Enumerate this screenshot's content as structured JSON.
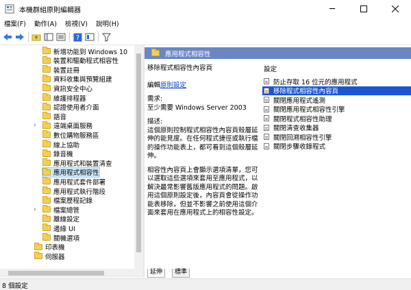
{
  "window": {
    "title": "本機群組原則編輯器"
  },
  "menu": [
    "檔案(F)",
    "動作(A)",
    "檢視(V)",
    "說明(H)"
  ],
  "tree": {
    "items": [
      {
        "label": "新增功能到 Windows 10",
        "expandable": false
      },
      {
        "label": "裝置和驅動程式相容性",
        "expandable": false
      },
      {
        "label": "裝置註冊",
        "expandable": false
      },
      {
        "label": "資料收集與預覽組建",
        "expandable": false
      },
      {
        "label": "資訊安全中心",
        "expandable": false
      },
      {
        "label": "維護排程器",
        "expandable": false
      },
      {
        "label": "認證使用者介面",
        "expandable": false
      },
      {
        "label": "語音",
        "expandable": false
      },
      {
        "label": "遠端桌面服務",
        "expandable": true
      },
      {
        "label": "數位購物服務區",
        "expandable": false
      },
      {
        "label": "線上協助",
        "expandable": false
      },
      {
        "label": "錄音機",
        "expandable": false
      },
      {
        "label": "應用程式和裝置清查",
        "expandable": false
      },
      {
        "label": "應用程式相容性",
        "expandable": false,
        "selected": true
      },
      {
        "label": "應用程式套件部署",
        "expandable": false
      },
      {
        "label": "應用程式執行階段",
        "expandable": false
      },
      {
        "label": "檔案歷程記錄",
        "expandable": false
      },
      {
        "label": "檔案總管",
        "expandable": true
      },
      {
        "label": "離線設定",
        "expandable": false
      },
      {
        "label": "邊緣 UI",
        "expandable": false
      },
      {
        "label": "關機選項",
        "expandable": false
      }
    ],
    "parent_items": [
      {
        "label": "印表機",
        "expandable": false
      },
      {
        "label": "伺服器",
        "expandable": false
      }
    ]
  },
  "detail": {
    "header": "應用程式相容性",
    "policy_title": "移除程式相容性內容頁",
    "edit_prefix": "編輯",
    "edit_link": "原則設定",
    "req_label": "需求:",
    "req_value": "至少需要 Windows Server 2003",
    "desc_label": "描述:",
    "desc_p1": "這個原則控制程式相容性內容頁殼層延伸的能見度。在任何程式捷徑或執行檔的操作功能表上，都可看到這個殼層延伸。",
    "desc_p2": "相容性內容頁上會顯示選項清單，您可以選取這些選項來套用至應用程式，以解決最常影響舊版應用程式的問題。啟用這個原則設定後，內容頁會從操作功能表移除，但並不影響之前使用這個介面來套用在應用程式上的相容性設定。"
  },
  "settings": {
    "column_header": "設定",
    "items": [
      {
        "label": "防止存取 16 位元的應用程式",
        "active": false
      },
      {
        "label": "移除程式相容性內容頁",
        "active": true
      },
      {
        "label": "關閉應用程式遙測",
        "active": false
      },
      {
        "label": "關閉應用程式相容性引擎",
        "active": false
      },
      {
        "label": "關閉程式相容性助理",
        "active": false
      },
      {
        "label": "關閉清查收集器",
        "active": false
      },
      {
        "label": "關閉回溯相容性引擎",
        "active": false
      },
      {
        "label": "關閉步驟收錄程式",
        "active": false
      }
    ]
  },
  "tabs": [
    "延伸",
    "標準"
  ],
  "status": {
    "text": "8 個設定"
  }
}
